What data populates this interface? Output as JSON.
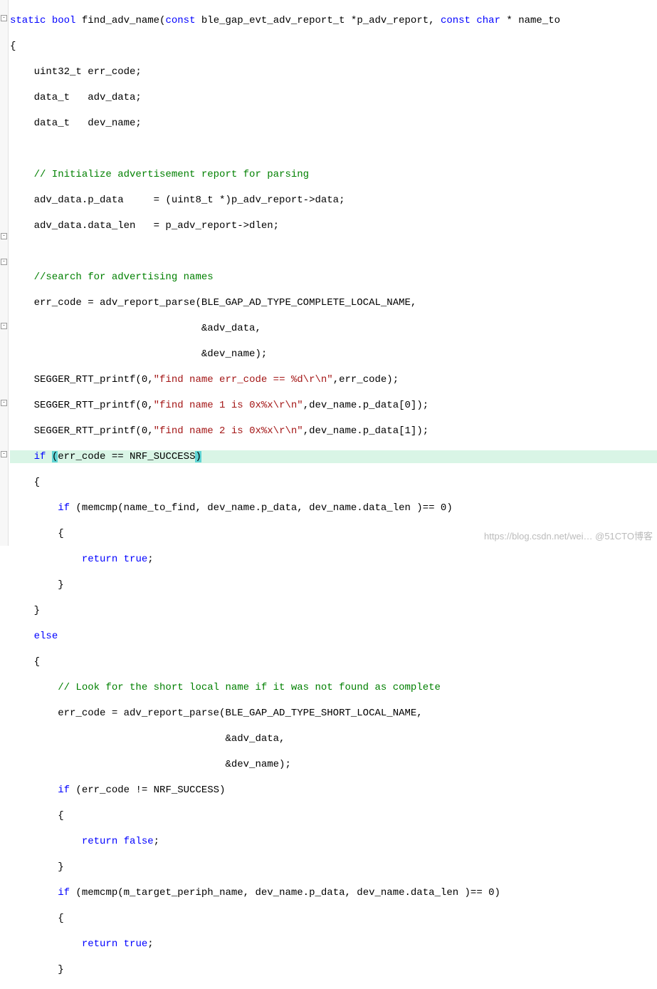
{
  "code": {
    "l1_kw1": "static",
    "l1_kw2": "bool",
    "l1_fn": " find_adv_name(",
    "l1_kw3": "const",
    "l1_p1": " ble_gap_evt_adv_report_t *p_adv_report, ",
    "l1_kw4": "const",
    "l1_kw5": "char",
    "l1_p2": " * name_to",
    "l2": "{",
    "l3": "    uint32_t err_code;",
    "l4": "    data_t   adv_data;",
    "l5": "    data_t   dev_name;",
    "l6": "",
    "l7_cm": "    // Initialize advertisement report for parsing",
    "l8": "    adv_data.p_data     = (uint8_t *)p_adv_report->data;",
    "l9": "    adv_data.data_len   = p_adv_report->dlen;",
    "l10": "",
    "l11_cm": "    //search for advertising names",
    "l12": "    err_code = adv_report_parse(BLE_GAP_AD_TYPE_COMPLETE_LOCAL_NAME,",
    "l13": "                                &adv_data,",
    "l14": "                                &dev_name);",
    "l15a": "    SEGGER_RTT_printf(0,",
    "l15s": "\"find name err_code == %d\\r\\n\"",
    "l15b": ",err_code);",
    "l16a": "    SEGGER_RTT_printf(0,",
    "l16s": "\"find name 1 is 0x%x\\r\\n\"",
    "l16b": ",dev_name.p_data[0]);",
    "l17a": "    SEGGER_RTT_printf(0,",
    "l17s": "\"find name 2 is 0x%x\\r\\n\"",
    "l17b": ",dev_name.p_data[1]);",
    "l18_pre": "    ",
    "l18_kw": "if",
    "l18_sp": " ",
    "l18_br1": "(",
    "l18_mid": "err_code == NRF_SUCCESS",
    "l18_br2": ")",
    "l19": "    {",
    "l20_pre": "        ",
    "l20_kw": "if",
    "l20_rest": " (memcmp(name_to_find, dev_name.p_data, dev_name.data_len )== 0)",
    "l21": "        {",
    "l22_pre": "            ",
    "l22_kw": "return",
    "l22_sp": " ",
    "l22_kw2": "true",
    "l22_end": ";",
    "l23": "        }",
    "l24": "    }",
    "l25_pre": "    ",
    "l25_kw": "else",
    "l26": "    {",
    "l27_cm": "        // Look for the short local name if it was not found as complete",
    "l28": "        err_code = adv_report_parse(BLE_GAP_AD_TYPE_SHORT_LOCAL_NAME,",
    "l29": "                                    &adv_data,",
    "l30": "                                    &dev_name);",
    "l31_pre": "        ",
    "l31_kw": "if",
    "l31_rest": " (err_code != NRF_SUCCESS)",
    "l32": "        {",
    "l33_pre": "            ",
    "l33_kw": "return",
    "l33_sp": " ",
    "l33_kw2": "false",
    "l33_end": ";",
    "l34": "        }",
    "l35_pre": "        ",
    "l35_kw": "if",
    "l35_rest": " (memcmp(m_target_periph_name, dev_name.p_data, dev_name.data_len )== 0)",
    "l36": "        {",
    "l37_pre": "            ",
    "l37_kw": "return",
    "l37_sp": " ",
    "l37_kw2": "true",
    "l37_end": ";",
    "l38": "        }"
  },
  "watermark": "https://blog.csdn.net/wei…  @51CTO博客"
}
